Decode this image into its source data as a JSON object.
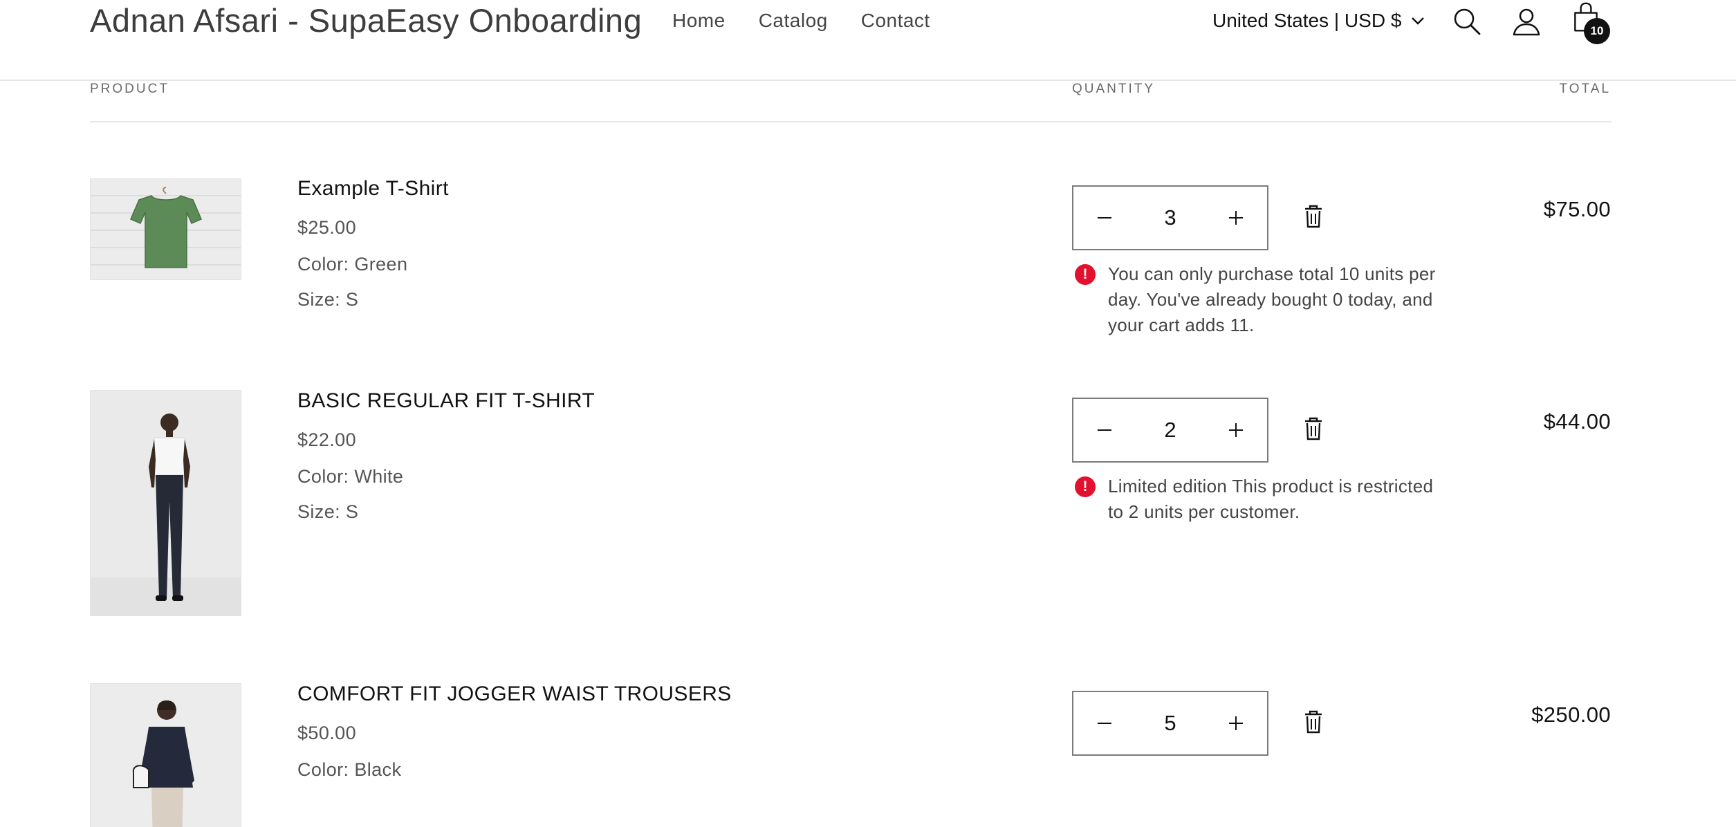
{
  "header": {
    "store_title": "Adnan Afsari - SupaEasy Onboarding",
    "nav": [
      "Home",
      "Catalog",
      "Contact"
    ],
    "locale": "United States | USD $",
    "cart_count": "10"
  },
  "table": {
    "headers": {
      "product": "PRODUCT",
      "quantity": "QUANTITY",
      "total": "TOTAL"
    }
  },
  "items": [
    {
      "name": "Example T-Shirt",
      "price": "$25.00",
      "color": "Color: Green",
      "size": "Size: S",
      "quantity": "3",
      "total": "$75.00",
      "error": "You can only purchase total 10 units per day. You've already bought 0 today, and your cart adds 11."
    },
    {
      "name": "BASIC REGULAR FIT T-SHIRT",
      "price": "$22.00",
      "color": "Color: White",
      "size": "Size: S",
      "quantity": "2",
      "total": "$44.00",
      "error": "Limited edition This product is restricted to 2 units per customer."
    },
    {
      "name": "COMFORT FIT JOGGER WAIST TROUSERS",
      "price": "$50.00",
      "color": "Color: Black",
      "quantity": "5",
      "total": "$250.00"
    }
  ],
  "icons": {
    "search": "search-icon",
    "account": "account-icon",
    "cart": "cart-icon",
    "delete": "trash-icon",
    "error": "error-icon",
    "locale_chevron": "chevron-down-icon"
  },
  "colors": {
    "error": "#e4112e",
    "text": "#121212",
    "border": "#7a7a7a"
  }
}
